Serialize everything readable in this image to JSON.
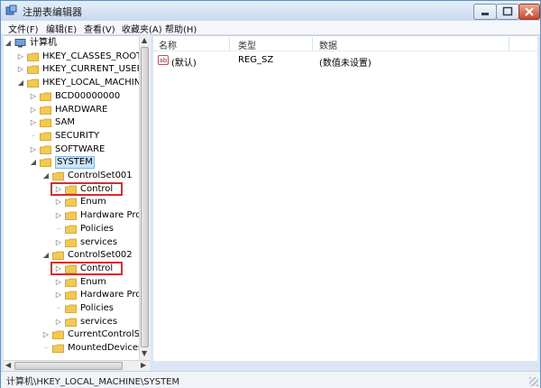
{
  "window": {
    "title": "注册表编辑器"
  },
  "menu": [
    "文件(F)",
    "编辑(E)",
    "查看(V)",
    "收藏夹(A)",
    "帮助(H)"
  ],
  "tree": [
    {
      "label": "计算机",
      "level": 0,
      "expander": "expanded",
      "icon": "computer-icon"
    },
    {
      "label": "HKEY_CLASSES_ROOT",
      "level": 1,
      "expander": "collapsed",
      "icon": "folder-icon"
    },
    {
      "label": "HKEY_CURRENT_USER",
      "level": 1,
      "expander": "collapsed",
      "icon": "folder-icon"
    },
    {
      "label": "HKEY_LOCAL_MACHINE",
      "level": 1,
      "expander": "expanded",
      "icon": "folder-icon"
    },
    {
      "label": "BCD00000000",
      "level": 2,
      "expander": "collapsed",
      "icon": "folder-icon"
    },
    {
      "label": "HARDWARE",
      "level": 2,
      "expander": "collapsed",
      "icon": "folder-icon"
    },
    {
      "label": "SAM",
      "level": 2,
      "expander": "collapsed",
      "icon": "folder-icon"
    },
    {
      "label": "SECURITY",
      "level": 2,
      "expander": "none",
      "icon": "folder-icon"
    },
    {
      "label": "SOFTWARE",
      "level": 2,
      "expander": "collapsed",
      "icon": "folder-icon"
    },
    {
      "label": "SYSTEM",
      "level": 2,
      "expander": "expanded",
      "icon": "folder-icon",
      "selected": true
    },
    {
      "label": "ControlSet001",
      "level": 3,
      "expander": "expanded",
      "icon": "folder-icon"
    },
    {
      "label": "Control",
      "level": 4,
      "expander": "collapsed",
      "icon": "folder-icon",
      "highlighted": true
    },
    {
      "label": "Enum",
      "level": 4,
      "expander": "collapsed",
      "icon": "folder-icon"
    },
    {
      "label": "Hardware Pro",
      "level": 4,
      "expander": "collapsed",
      "icon": "folder-icon"
    },
    {
      "label": "Policies",
      "level": 4,
      "expander": "none",
      "icon": "folder-icon"
    },
    {
      "label": "services",
      "level": 4,
      "expander": "collapsed",
      "icon": "folder-icon"
    },
    {
      "label": "ControlSet002",
      "level": 3,
      "expander": "expanded",
      "icon": "folder-icon"
    },
    {
      "label": "Control",
      "level": 4,
      "expander": "collapsed",
      "icon": "folder-icon",
      "highlighted": true
    },
    {
      "label": "Enum",
      "level": 4,
      "expander": "collapsed",
      "icon": "folder-icon"
    },
    {
      "label": "Hardware Pro",
      "level": 4,
      "expander": "collapsed",
      "icon": "folder-icon"
    },
    {
      "label": "Policies",
      "level": 4,
      "expander": "none",
      "icon": "folder-icon"
    },
    {
      "label": "services",
      "level": 4,
      "expander": "collapsed",
      "icon": "folder-icon"
    },
    {
      "label": "CurrentControlSe",
      "level": 3,
      "expander": "collapsed",
      "icon": "folder-icon"
    },
    {
      "label": "MountedDevices",
      "level": 3,
      "expander": "none",
      "icon": "folder-icon"
    }
  ],
  "list": {
    "headers": [
      "名称",
      "类型",
      "数据"
    ],
    "rows": [
      {
        "name": "(默认)",
        "type": "REG_SZ",
        "data": "(数值未设置)",
        "icon_text": "ab"
      }
    ]
  },
  "status": "计算机\\HKEY_LOCAL_MACHINE\\SYSTEM",
  "colors": {
    "highlight_border": "#d62e2e",
    "selection": "#cde4f7",
    "folder": "#f2c955"
  }
}
